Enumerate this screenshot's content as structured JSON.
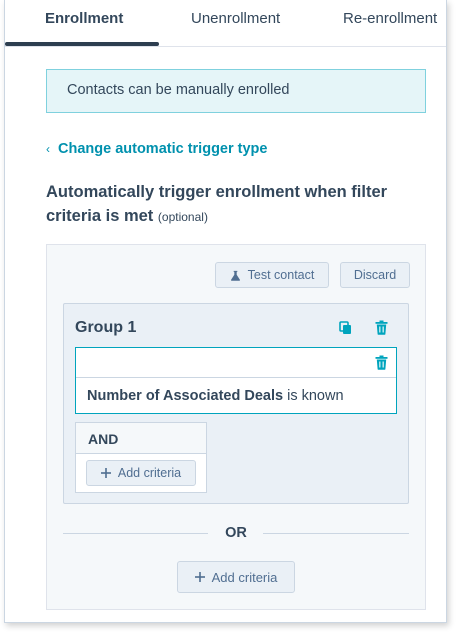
{
  "tabs": [
    {
      "label": "Enrollment",
      "active": true
    },
    {
      "label": "Unenrollment",
      "active": false
    },
    {
      "label": "Re-enrollment",
      "active": false
    }
  ],
  "info_banner": {
    "text": "Contacts can be manually enrolled"
  },
  "back_link": {
    "label": "Change automatic trigger type",
    "icon": "chevron-left-icon"
  },
  "section": {
    "heading": "Automatically trigger enrollment when filter criteria is met",
    "optional": "(optional)"
  },
  "filter_toolbar": {
    "test_contact": "Test contact",
    "test_contact_icon": "flask-icon",
    "discard": "Discard"
  },
  "group": {
    "title": "Group 1",
    "clone_icon": "copy-icon",
    "delete_icon": "trash-icon",
    "criteria": {
      "property": "Number of Associated Deals",
      "condition": "is known"
    },
    "and_block": {
      "label": "AND",
      "add_criteria": "Add criteria"
    }
  },
  "or_label": "OR",
  "add_criteria": "Add criteria",
  "colors": {
    "accent": "#0091ae",
    "criteria_border": "#00a4bd",
    "banner_bg": "#e5f5f8",
    "trash": "#00a4bd",
    "text": "#33475b"
  }
}
